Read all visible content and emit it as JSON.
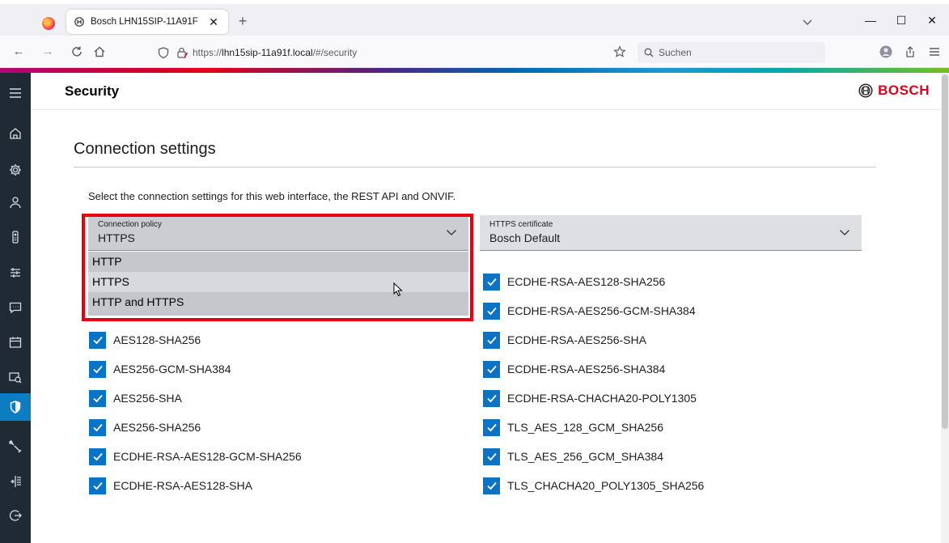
{
  "browser": {
    "tab_title": "Bosch LHN15SIP-11A91F",
    "url_prefix": "https://",
    "url_host": "lhn15sip-11a91f.local",
    "url_path": "/#/security",
    "search_placeholder": "Suchen"
  },
  "header": {
    "title": "Security",
    "brand": "BOSCH"
  },
  "sidebar": {
    "active_item": "security",
    "items": [
      "menu",
      "home",
      "settings",
      "user",
      "camera",
      "sliders",
      "chat",
      "calendar",
      "recording",
      "security",
      "tools",
      "layout",
      "logout"
    ]
  },
  "section": {
    "title": "Connection settings",
    "intro": "Select the connection settings for this web interface, the REST API and ONVIF."
  },
  "connection_policy": {
    "label": "Connection policy",
    "value": "HTTPS",
    "options": [
      "HTTP",
      "HTTPS",
      "HTTP and HTTPS"
    ],
    "hovered_option": "HTTPS"
  },
  "https_certificate": {
    "label": "HTTPS certificate",
    "value": "Bosch Default"
  },
  "ciphers_left": [
    {
      "label": "AES128-SHA256",
      "checked": true
    },
    {
      "label": "AES256-GCM-SHA384",
      "checked": true
    },
    {
      "label": "AES256-SHA",
      "checked": true
    },
    {
      "label": "AES256-SHA256",
      "checked": true
    },
    {
      "label": "ECDHE-RSA-AES128-GCM-SHA256",
      "checked": true
    },
    {
      "label": "ECDHE-RSA-AES128-SHA",
      "checked": true
    }
  ],
  "ciphers_right": [
    {
      "label": "ECDHE-RSA-AES128-SHA256",
      "checked": true
    },
    {
      "label": "ECDHE-RSA-AES256-GCM-SHA384",
      "checked": true
    },
    {
      "label": "ECDHE-RSA-AES256-SHA",
      "checked": true
    },
    {
      "label": "ECDHE-RSA-AES256-SHA384",
      "checked": true
    },
    {
      "label": "ECDHE-RSA-CHACHA20-POLY1305",
      "checked": true
    },
    {
      "label": "TLS_AES_128_GCM_SHA256",
      "checked": true
    },
    {
      "label": "TLS_AES_256_GCM_SHA384",
      "checked": true
    },
    {
      "label": "TLS_CHACHA20_POLY1305_SHA256",
      "checked": true
    }
  ],
  "colors": {
    "accent": "#0b73c6",
    "sidebar_bg": "#1f2a35",
    "brand_red": "#e2001a",
    "highlight_red": "#e8000e"
  }
}
